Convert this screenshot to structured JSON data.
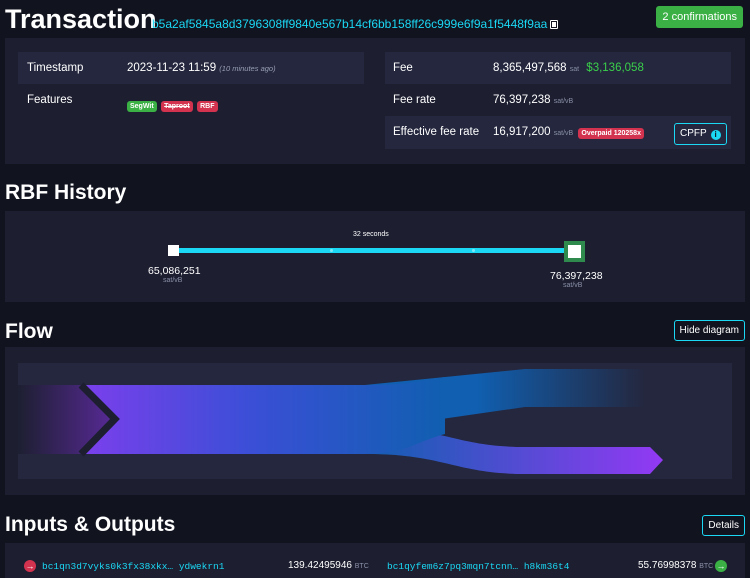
{
  "header": {
    "title": "Transaction",
    "txid": "b5a2af5845a8d3796308ff9840e567b14cf6bb158ff26c999e6f9a1f5448f9aa",
    "confirmations": "2 confirmations"
  },
  "details": {
    "timestamp_label": "Timestamp",
    "timestamp_value": "2023-11-23 11:59",
    "timestamp_ago": "(10 minutes ago)",
    "features_label": "Features",
    "features": [
      "SegWit",
      "Taproot",
      "RBF"
    ],
    "fee_label": "Fee",
    "fee_value": "8,365,497,568",
    "fee_unit": "sat",
    "fee_usd": "$3,136,058",
    "fee_rate_label": "Fee rate",
    "fee_rate_value": "76,397,238",
    "fee_rate_unit": "sat/vB",
    "eff_fee_rate_label": "Effective fee rate",
    "eff_fee_rate_value": "16,917,200",
    "eff_fee_rate_unit": "sat/vB",
    "overpaid_badge": "Overpaid 120258x",
    "cpfp_button": "CPFP"
  },
  "rbf": {
    "title": "RBF History",
    "interval": "32 seconds",
    "left_value": "65,086,251",
    "left_unit": "sat/vB",
    "right_value": "76,397,238",
    "right_unit": "sat/vB"
  },
  "flow": {
    "title": "Flow",
    "toggle_button": "Hide diagram"
  },
  "io": {
    "title": "Inputs & Outputs",
    "details_button": "Details",
    "input_address": "bc1qn3d7vyks0k3fx38xkx… ydwekrn1",
    "input_amount": "139.42495946",
    "input_unit": "BTC",
    "output_address": "bc1qyfem6z7pq3mqn7tcnn… h8km36t4",
    "output_amount": "55.76998378",
    "output_unit": "BTC"
  },
  "colors": {
    "accent": "#1bd8f4",
    "confirm_green": "#3bb145",
    "badge_red": "#d4334f",
    "usd_green": "#3bcf4b",
    "flow_purple": "#9339f4",
    "flow_blue": "#105fb0"
  }
}
